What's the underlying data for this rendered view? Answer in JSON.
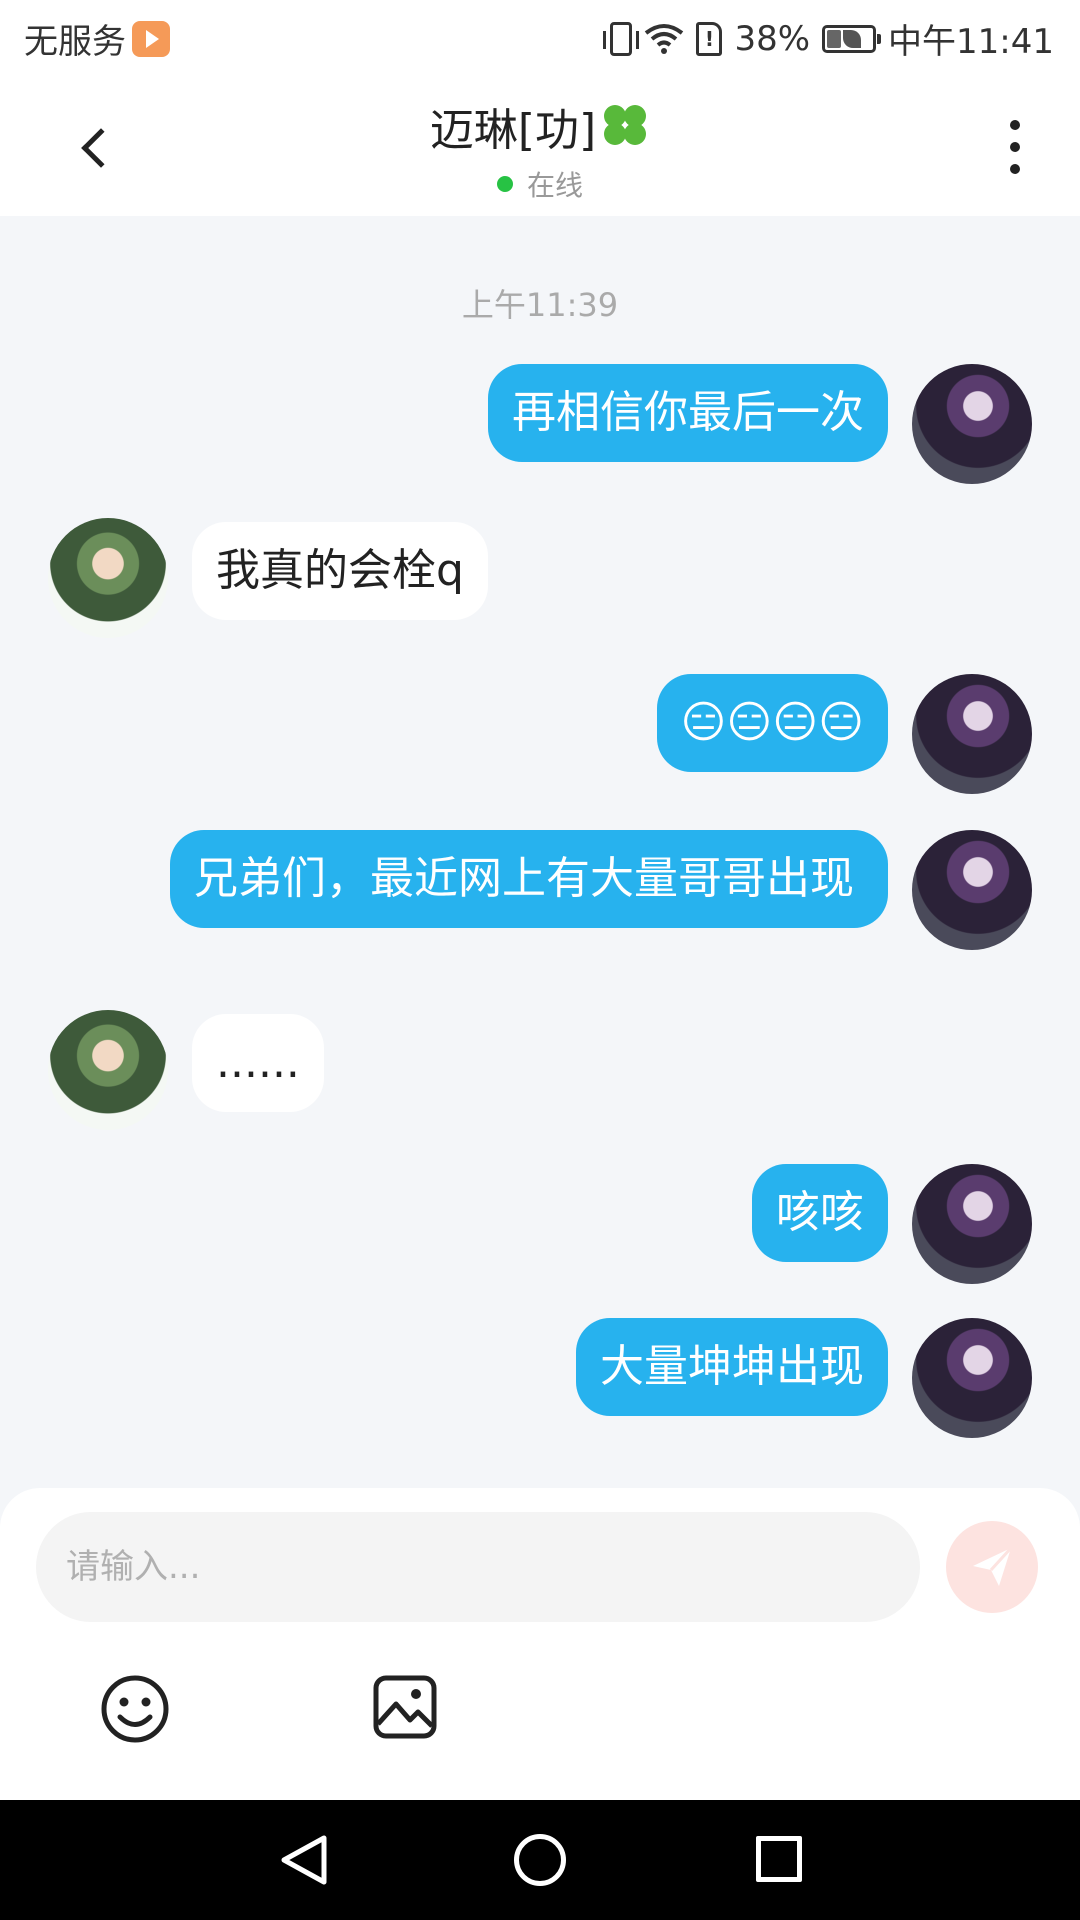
{
  "status_bar": {
    "carrier": "无服务",
    "battery": "38%",
    "time": "中午11:41"
  },
  "header": {
    "title": "迈琳[功]",
    "status": "在线"
  },
  "chat": {
    "timestamp": "上午11:39",
    "messages": [
      {
        "sender": "self",
        "text": "再相信你最后一次"
      },
      {
        "sender": "other",
        "text": "我真的会栓q"
      },
      {
        "sender": "self",
        "text": "😑😑😑😑"
      },
      {
        "sender": "self",
        "text": "兄弟们，最近网上有大量哥哥出现"
      },
      {
        "sender": "other",
        "text": "......"
      },
      {
        "sender": "self",
        "text": "咳咳"
      },
      {
        "sender": "self",
        "text": "大量坤坤出现"
      }
    ]
  },
  "composer": {
    "placeholder": "请输入...",
    "send_icon": "send-icon",
    "emoji_icon": "emoji-icon",
    "image_icon": "image-icon"
  },
  "colors": {
    "self_bubble": "#27b2ee",
    "other_bubble": "#ffffff",
    "online_dot": "#27c244",
    "send_button": "#fde3e0"
  }
}
